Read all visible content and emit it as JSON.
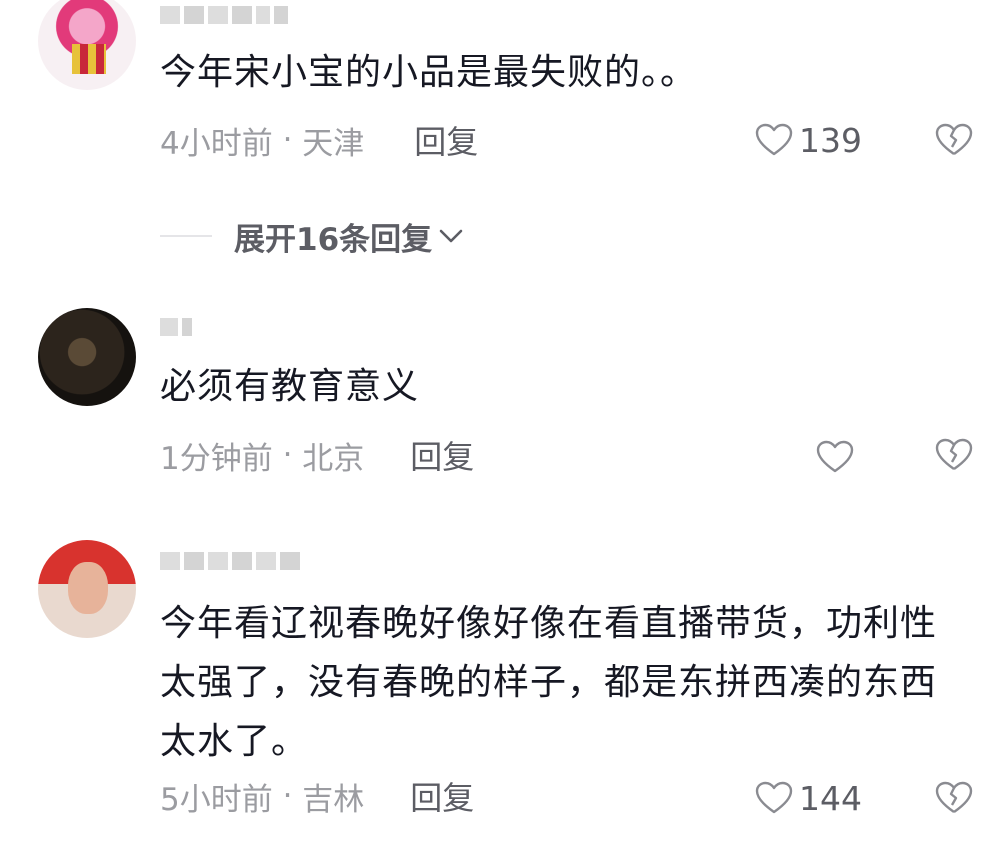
{
  "comments": [
    {
      "text": "今年宋小宝的小品是最失败的。。",
      "time": "4小时前",
      "location": "天津",
      "reply_label": "回复",
      "likes": "139",
      "avatar_icon": "cartoon-avatar"
    },
    {
      "text": "必须有教育意义",
      "time": "1分钟前",
      "location": "北京",
      "reply_label": "回复",
      "likes": "",
      "avatar_icon": "dark-avatar"
    },
    {
      "text": "今年看辽视春晚好像好像在看直播带货，功利性太强了，没有春晚的样子，都是东拼西凑的东西太水了。",
      "time": "5小时前",
      "location": "吉林",
      "reply_label": "回复",
      "likes": "144",
      "avatar_icon": "flag-avatar"
    }
  ],
  "expand_replies": {
    "label": "展开16条回复"
  },
  "icons": {
    "like": "heart-outline-icon",
    "dislike": "broken-heart-icon",
    "expand": "chevron-down-icon"
  },
  "colors": {
    "text": "#161823",
    "meta": "#9b9ca1",
    "secondary": "#5c5d64"
  }
}
